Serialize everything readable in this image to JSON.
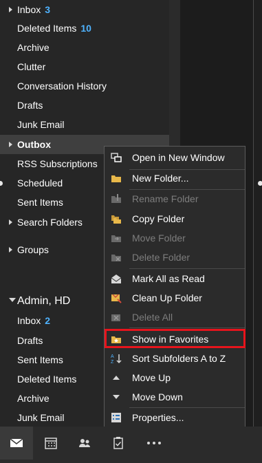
{
  "folders": {
    "inbox": {
      "label": "Inbox",
      "count": "3"
    },
    "deleted": {
      "label": "Deleted Items",
      "count": "10"
    },
    "archive": "Archive",
    "clutter": "Clutter",
    "conversation_history": "Conversation History",
    "drafts": "Drafts",
    "junk": "Junk Email",
    "outbox": "Outbox",
    "rss": "RSS Subscriptions",
    "scheduled": "Scheduled",
    "sent": "Sent Items",
    "search_folders": "Search Folders",
    "groups": "Groups"
  },
  "account2": {
    "name": "Admin, HD",
    "inbox": {
      "label": "Inbox",
      "count": "2"
    },
    "drafts": "Drafts",
    "sent": "Sent Items",
    "deleted": "Deleted Items",
    "archive": "Archive",
    "junk": "Junk Email"
  },
  "context_menu": {
    "open_new_window": "Open in New Window",
    "new_folder": "New Folder...",
    "rename_folder": "Rename Folder",
    "copy_folder": "Copy Folder",
    "move_folder": "Move Folder",
    "delete_folder": "Delete Folder",
    "mark_all_read": "Mark All as Read",
    "clean_up_folder": "Clean Up Folder",
    "delete_all": "Delete All",
    "show_in_favorites": "Show in Favorites",
    "sort_subfolders": "Sort Subfolders A to Z",
    "move_up": "Move Up",
    "move_down": "Move Down",
    "properties": "Properties..."
  },
  "bottom_nav": [
    "mail-icon",
    "calendar-icon",
    "people-icon",
    "tasks-icon",
    "more-icon"
  ],
  "colors": {
    "accent": "#4fb3ff",
    "highlight_box": "#e8141c"
  }
}
